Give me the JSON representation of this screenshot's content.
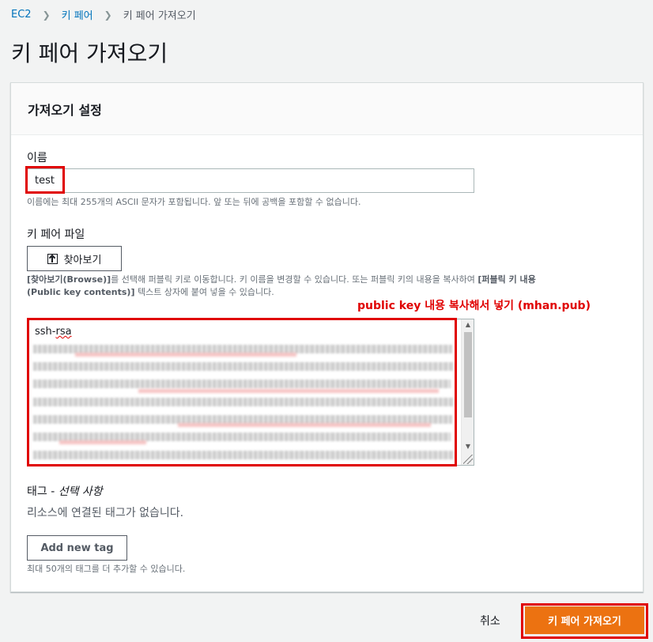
{
  "breadcrumb": {
    "root": "EC2",
    "section": "키 페어",
    "current": "키 페어 가져오기"
  },
  "page_title": "키 페어 가져오기",
  "panel": {
    "title": "가져오기 설정",
    "name_label": "이름",
    "name_value": "test",
    "name_hint": "이름에는 최대 255개의 ASCII 문자가 포함됩니다. 앞 또는 뒤에 공백을 포함할 수 없습니다.",
    "keyfile_label": "키 페어 파일",
    "browse_button": "찾아보기",
    "browse_hint_line1_a": "[찾아보기(Browse)]",
    "browse_hint_line1_b": "를 선택해 퍼블릭 키로 이동합니다. 키 이름을 변경할 수 있습니다. 또는 퍼블릭 키의 내용을 복사하여 ",
    "browse_hint_line1_c": "[퍼블릭 키 내용",
    "browse_hint_line2_a": "(Public key contents)]",
    "browse_hint_line2_b": " 텍스트 상자에 붙여 넣을 수 있습니다.",
    "key_content_first_line_prefix": "ssh-",
    "key_content_first_line_word": "rsa",
    "annotation": "public key 내용 복사해서 넣기 (mhan.pub)",
    "tags_label": "태그 -",
    "tags_optional": "선택 사항",
    "no_tags": "리소스에 연결된 태그가 없습니다.",
    "add_tag_button": "Add new tag",
    "tags_hint": "최대 50개의 태그를 더 추가할 수 있습니다."
  },
  "footer": {
    "cancel": "취소",
    "submit": "키 페어 가져오기"
  },
  "colors": {
    "accent": "#ec7211",
    "link": "#0073bb",
    "highlight_red": "#e00000"
  }
}
